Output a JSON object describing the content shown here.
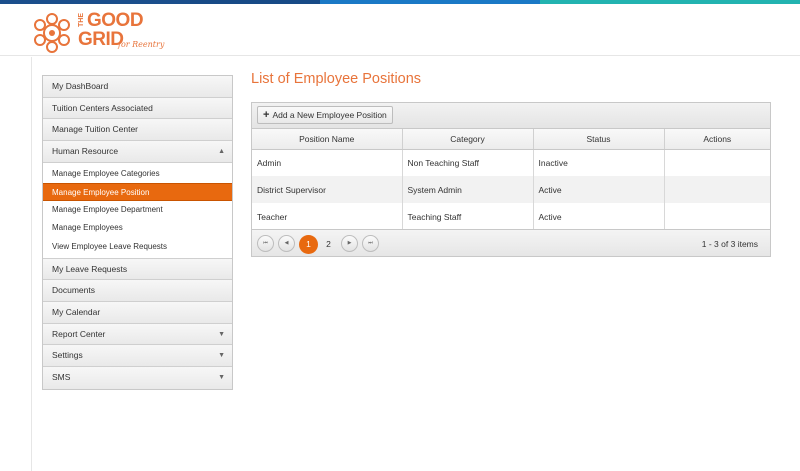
{
  "brand": {
    "the": "THE",
    "good": "GOOD",
    "grid": "GRID",
    "tagline": "for Reentry",
    "accent": "#e8743b",
    "topbar_colors": [
      "#1b4f8c",
      "#1a79c6",
      "#1e9bd7",
      "#22b3b0"
    ]
  },
  "sidebar": {
    "items": [
      {
        "label": "My DashBoard"
      },
      {
        "label": "Tuition Centers Associated"
      },
      {
        "label": "Manage Tuition Center"
      },
      {
        "label": "Human Resource",
        "caret": "▲"
      },
      {
        "label": "My Leave Requests"
      },
      {
        "label": "Documents"
      },
      {
        "label": "My Calendar"
      },
      {
        "label": "Report Center",
        "caret": "▼"
      },
      {
        "label": "Settings",
        "caret": "▼"
      },
      {
        "label": "SMS",
        "caret": "▼"
      }
    ],
    "hr_subitems": [
      {
        "label": "Manage Employee Categories"
      },
      {
        "label": "Manage Employee Position"
      },
      {
        "label": "Manage Employee Department"
      },
      {
        "label": "Manage Employees"
      },
      {
        "label": "View Employee Leave Requests"
      }
    ]
  },
  "main": {
    "title": "List of Employee Positions",
    "add_button": "Add a New Employee Position",
    "add_icon": "+",
    "columns": [
      "Position Name",
      "Category",
      "Status",
      "Actions"
    ],
    "rows": [
      {
        "name": "Admin",
        "category": "Non Teaching Staff",
        "status": "Inactive",
        "actions": ""
      },
      {
        "name": "District Supervisor",
        "category": "System Admin",
        "status": "Active",
        "actions": ""
      },
      {
        "name": "Teacher",
        "category": "Teaching Staff",
        "status": "Active",
        "actions": ""
      }
    ]
  },
  "pager": {
    "first": "⏮",
    "prev": "◀",
    "next": "▶",
    "last": "⏭",
    "pages": [
      "1",
      "2"
    ],
    "info": "1 - 3 of 3 items"
  }
}
